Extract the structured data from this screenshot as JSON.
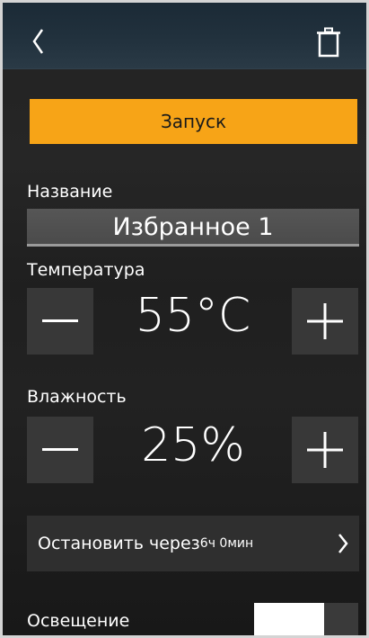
{
  "header": {
    "back_icon": "chevron-left-icon",
    "delete_icon": "trash-icon"
  },
  "start_button": {
    "label": "Запуск",
    "color": "#f7a417"
  },
  "name": {
    "label": "Название",
    "value": "Избранное 1"
  },
  "temperature": {
    "label": "Температура",
    "value": "55°C",
    "decrement_icon": "minus-icon",
    "increment_icon": "plus-icon"
  },
  "humidity": {
    "label": "Влажность",
    "value": "25%",
    "decrement_icon": "minus-icon",
    "increment_icon": "plus-icon"
  },
  "stop_timer": {
    "label": "Остановить через",
    "time": "6ч 0мин",
    "chevron_icon": "chevron-right-icon"
  },
  "lighting": {
    "label": "Освещение",
    "enabled": false
  }
}
